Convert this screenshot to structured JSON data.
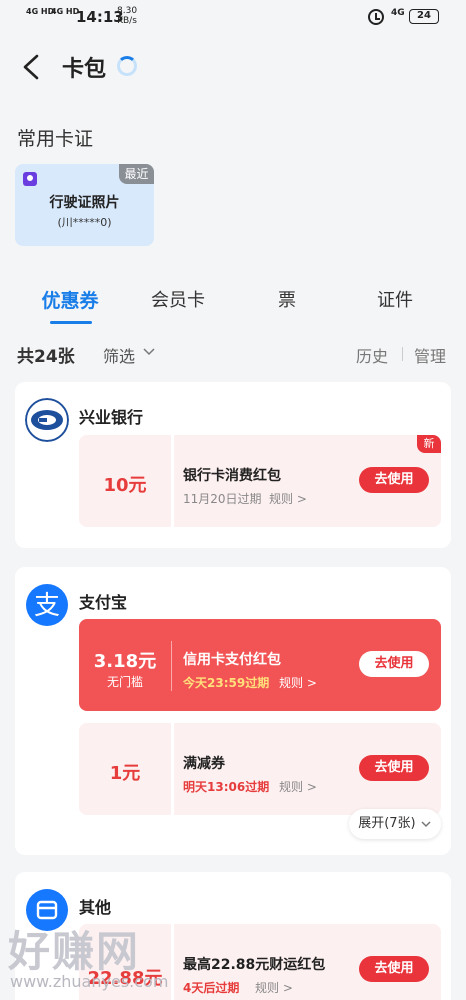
{
  "status": {
    "signal1": "4G HD",
    "signal2": "4G HD",
    "time": "14:13",
    "speed_value": "8.30",
    "speed_unit": "KB/s",
    "network": "4G",
    "battery": "24"
  },
  "header": {
    "title": "卡包"
  },
  "common_cards": {
    "title": "常用卡证",
    "items": [
      {
        "name": "行驶证照片",
        "sub": "(川*****0)",
        "tag": "最近"
      }
    ]
  },
  "tabs": [
    {
      "label": "优惠券",
      "active": true
    },
    {
      "label": "会员卡",
      "active": false
    },
    {
      "label": "票",
      "active": false
    },
    {
      "label": "证件",
      "active": false
    }
  ],
  "filter": {
    "count": "共24张",
    "filter_label": "筛选",
    "history": "历史",
    "manage": "管理"
  },
  "groups": [
    {
      "name": "兴业银行",
      "logo": "cib-bank-logo",
      "coupons": [
        {
          "amount": "10元",
          "sub": "",
          "name": "银行卡消费红包",
          "expiry": "11月20日过期",
          "rule": "规则 >",
          "button": "去使用",
          "badge": "新",
          "style": "pink"
        }
      ]
    },
    {
      "name": "支付宝",
      "logo": "alipay-logo",
      "coupons": [
        {
          "amount": "3.18元",
          "sub": "无门槛",
          "name": "信用卡支付红包",
          "expiry": "今天23:59过期",
          "rule": "规则 >",
          "button": "去使用",
          "style": "red"
        },
        {
          "amount": "1元",
          "sub": "",
          "name": "满减券",
          "expiry": "明天13:06过期",
          "rule": "规则 >",
          "button": "去使用",
          "style": "pink"
        }
      ],
      "expand": "展开(7张)"
    },
    {
      "name": "其他",
      "logo": "store-logo",
      "coupons": [
        {
          "amount": "22.88元",
          "sub": "",
          "name": "最高22.88元财运红包",
          "expiry": "4天后过期",
          "rule": "规则 >",
          "button": "去使用",
          "style": "pink"
        }
      ]
    }
  ],
  "watermark": {
    "text": "好赚网",
    "url": "www.zhuanyes.com"
  },
  "colors": {
    "accent": "#1a7ee8",
    "coupon_red": "#f25355",
    "button_red": "#e8343a",
    "coupon_pink": "#fdf0f0"
  }
}
